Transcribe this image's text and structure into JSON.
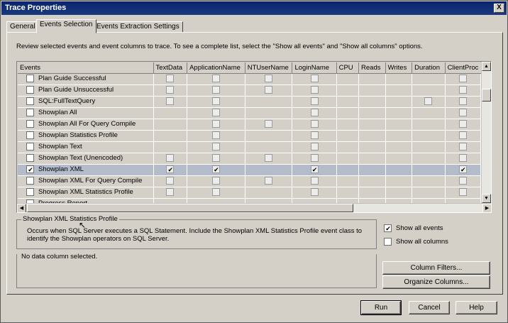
{
  "window": {
    "title": "Trace Properties",
    "close_glyph": "X"
  },
  "tabs": [
    {
      "label": "General"
    },
    {
      "label": "Events Selection"
    },
    {
      "label": "Events Extraction Settings"
    }
  ],
  "description": "Review selected events and event columns to trace. To see a complete list, select the \"Show all events\" and \"Show all columns\" options.",
  "grid": {
    "columns": [
      "Events",
      "TextData",
      "ApplicationName",
      "NTUserName",
      "LoginName",
      "CPU",
      "Reads",
      "Writes",
      "Duration",
      "ClientProc"
    ],
    "rows": [
      {
        "event": "Plan Guide Successful",
        "checked": false,
        "cells": [
          "box",
          "box",
          "box",
          "box",
          "",
          "",
          "",
          "",
          "box"
        ]
      },
      {
        "event": "Plan Guide Unsuccessful",
        "checked": false,
        "cells": [
          "box",
          "box",
          "box",
          "box",
          "",
          "",
          "",
          "",
          "box"
        ]
      },
      {
        "event": "SQL:FullTextQuery",
        "checked": false,
        "cells": [
          "box",
          "box",
          "",
          "box",
          "",
          "",
          "",
          "box",
          "box"
        ]
      },
      {
        "event": "Showplan All",
        "checked": false,
        "cells": [
          "",
          "box",
          "",
          "box",
          "",
          "",
          "",
          "",
          "box"
        ]
      },
      {
        "event": "Showplan All For Query Compile",
        "checked": false,
        "cells": [
          "",
          "box",
          "box",
          "box",
          "",
          "",
          "",
          "",
          "box"
        ]
      },
      {
        "event": "Showplan Statistics Profile",
        "checked": false,
        "cells": [
          "",
          "box",
          "",
          "box",
          "",
          "",
          "",
          "",
          "box"
        ]
      },
      {
        "event": "Showplan Text",
        "checked": false,
        "cells": [
          "",
          "box",
          "",
          "box",
          "",
          "",
          "",
          "",
          "box"
        ]
      },
      {
        "event": "Showplan Text (Unencoded)",
        "checked": false,
        "cells": [
          "box",
          "box",
          "box",
          "box",
          "",
          "",
          "",
          "",
          "box"
        ]
      },
      {
        "event": "Showplan XML",
        "checked": true,
        "selected": true,
        "cells": [
          "check",
          "check",
          "",
          "check",
          "",
          "",
          "",
          "",
          "check"
        ]
      },
      {
        "event": "Showplan XML For Query Compile",
        "checked": false,
        "cells": [
          "box",
          "box",
          "box",
          "box",
          "",
          "",
          "",
          "",
          "box"
        ]
      },
      {
        "event": "Showplan XML Statistics Profile",
        "checked": false,
        "cells": [
          "box",
          "box",
          "",
          "box",
          "",
          "",
          "",
          "",
          "box"
        ]
      },
      {
        "event": "Progress Report",
        "checked": false,
        "cells": [
          "",
          "",
          "",
          "",
          "",
          "",
          "",
          "",
          ""
        ]
      }
    ]
  },
  "event_info": {
    "title": "Showplan XML Statistics Profile",
    "text": "Occurs when SQL Server executes a SQL Statement. Include the Showplan XML Statistics Profile event class to identify the Showplan operators on SQL Server."
  },
  "column_info": {
    "text": "No data column selected."
  },
  "options": {
    "show_all_events": {
      "label": "Show all events",
      "checked": true
    },
    "show_all_columns": {
      "label": "Show all columns",
      "checked": false
    }
  },
  "buttons": {
    "column_filters": "Column Filters...",
    "organize_columns": "Organize Columns...",
    "run": "Run",
    "cancel": "Cancel",
    "help": "Help"
  }
}
